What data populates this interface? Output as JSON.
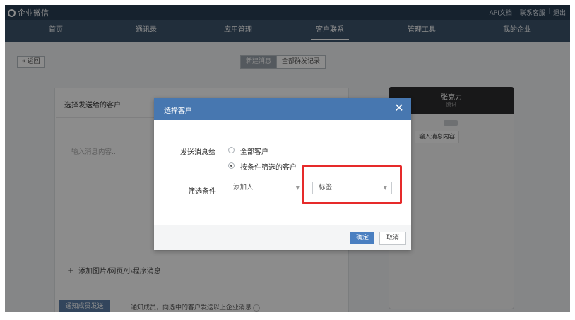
{
  "app": {
    "logo_text": "企业微信"
  },
  "topbar": {
    "links": [
      "API文档",
      "联系客服",
      "退出"
    ]
  },
  "nav": {
    "items": [
      "首页",
      "通讯录",
      "应用管理",
      "客户联系",
      "管理工具",
      "我的企业"
    ],
    "active_index": 3
  },
  "subbar": {
    "back_label": "« 返回",
    "tabs": [
      "新建消息",
      "全部群发记录"
    ],
    "active_tab": 0
  },
  "card": {
    "title": "选择发送给的客户",
    "message_placeholder": "输入消息内容...",
    "add_media_label": "添加图片/网页/小程序消息",
    "notify_button": "通知成员发送",
    "notify_text": "通知成员，向选中的客户发送以上企业消息"
  },
  "preview": {
    "name": "张克力",
    "subtitle": "腾讯",
    "bubble": "输入消息内容"
  },
  "modal": {
    "title": "选择客户",
    "send_to_label": "发送消息给",
    "options": [
      "全部客户",
      "按条件筛选的客户"
    ],
    "selected_option": 1,
    "filter_label": "筛选条件",
    "filter_select_1": "添加人",
    "filter_select_2": "标签",
    "ok_label": "确定",
    "cancel_label": "取消"
  },
  "colors": {
    "topbar": "#283f55",
    "nav": "#3c546c",
    "modal_header": "#4777b0",
    "primary_button": "#4a7fc1",
    "highlight": "#e62a2a"
  }
}
